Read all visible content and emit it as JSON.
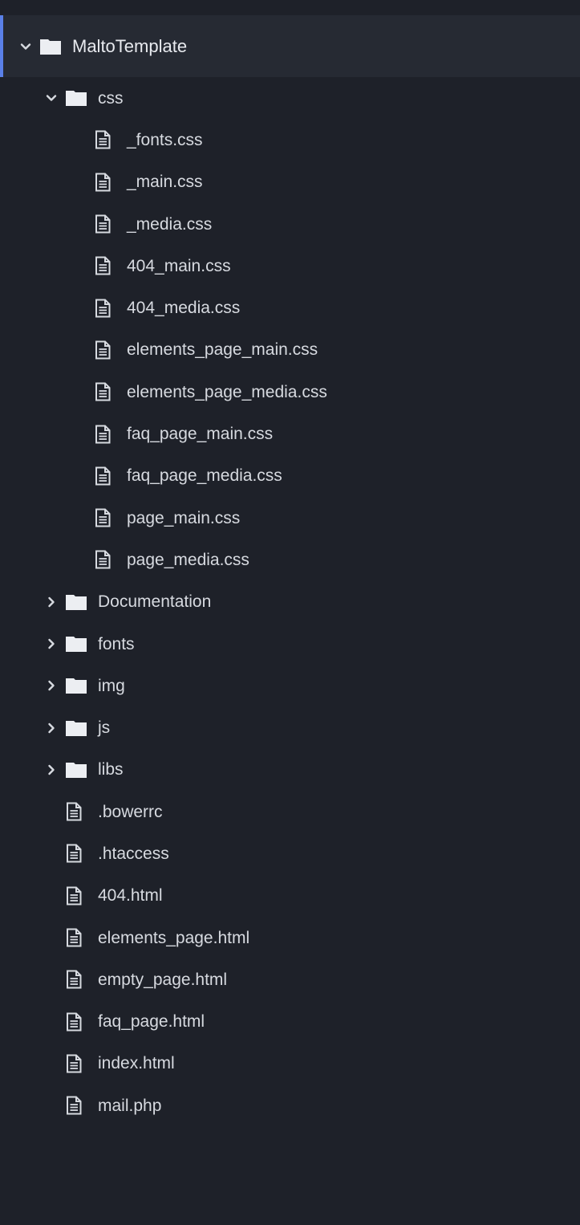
{
  "tree": {
    "root": {
      "label": "MaltoTemplate",
      "expanded": true
    },
    "css_folder": {
      "label": "css",
      "expanded": true,
      "files": [
        "_fonts.css",
        "_main.css",
        "_media.css",
        "404_main.css",
        "404_media.css",
        "elements_page_main.css",
        "elements_page_media.css",
        "faq_page_main.css",
        "faq_page_media.css",
        "page_main.css",
        "page_media.css"
      ]
    },
    "collapsed_folders": [
      "Documentation",
      "fonts",
      "img",
      "js",
      "libs"
    ],
    "root_files": [
      ".bowerrc",
      ".htaccess",
      "404.html",
      "elements_page.html",
      "empty_page.html",
      "faq_page.html",
      "index.html",
      "mail.php"
    ]
  },
  "colors": {
    "background": "#1e2129",
    "root_row_background": "#262a33",
    "accent": "#5a80e8",
    "text": "#d7dae0"
  },
  "icons": {
    "expanded": "chevron-down-icon",
    "collapsed": "chevron-right-icon",
    "folder": "folder-icon",
    "file": "file-icon"
  }
}
